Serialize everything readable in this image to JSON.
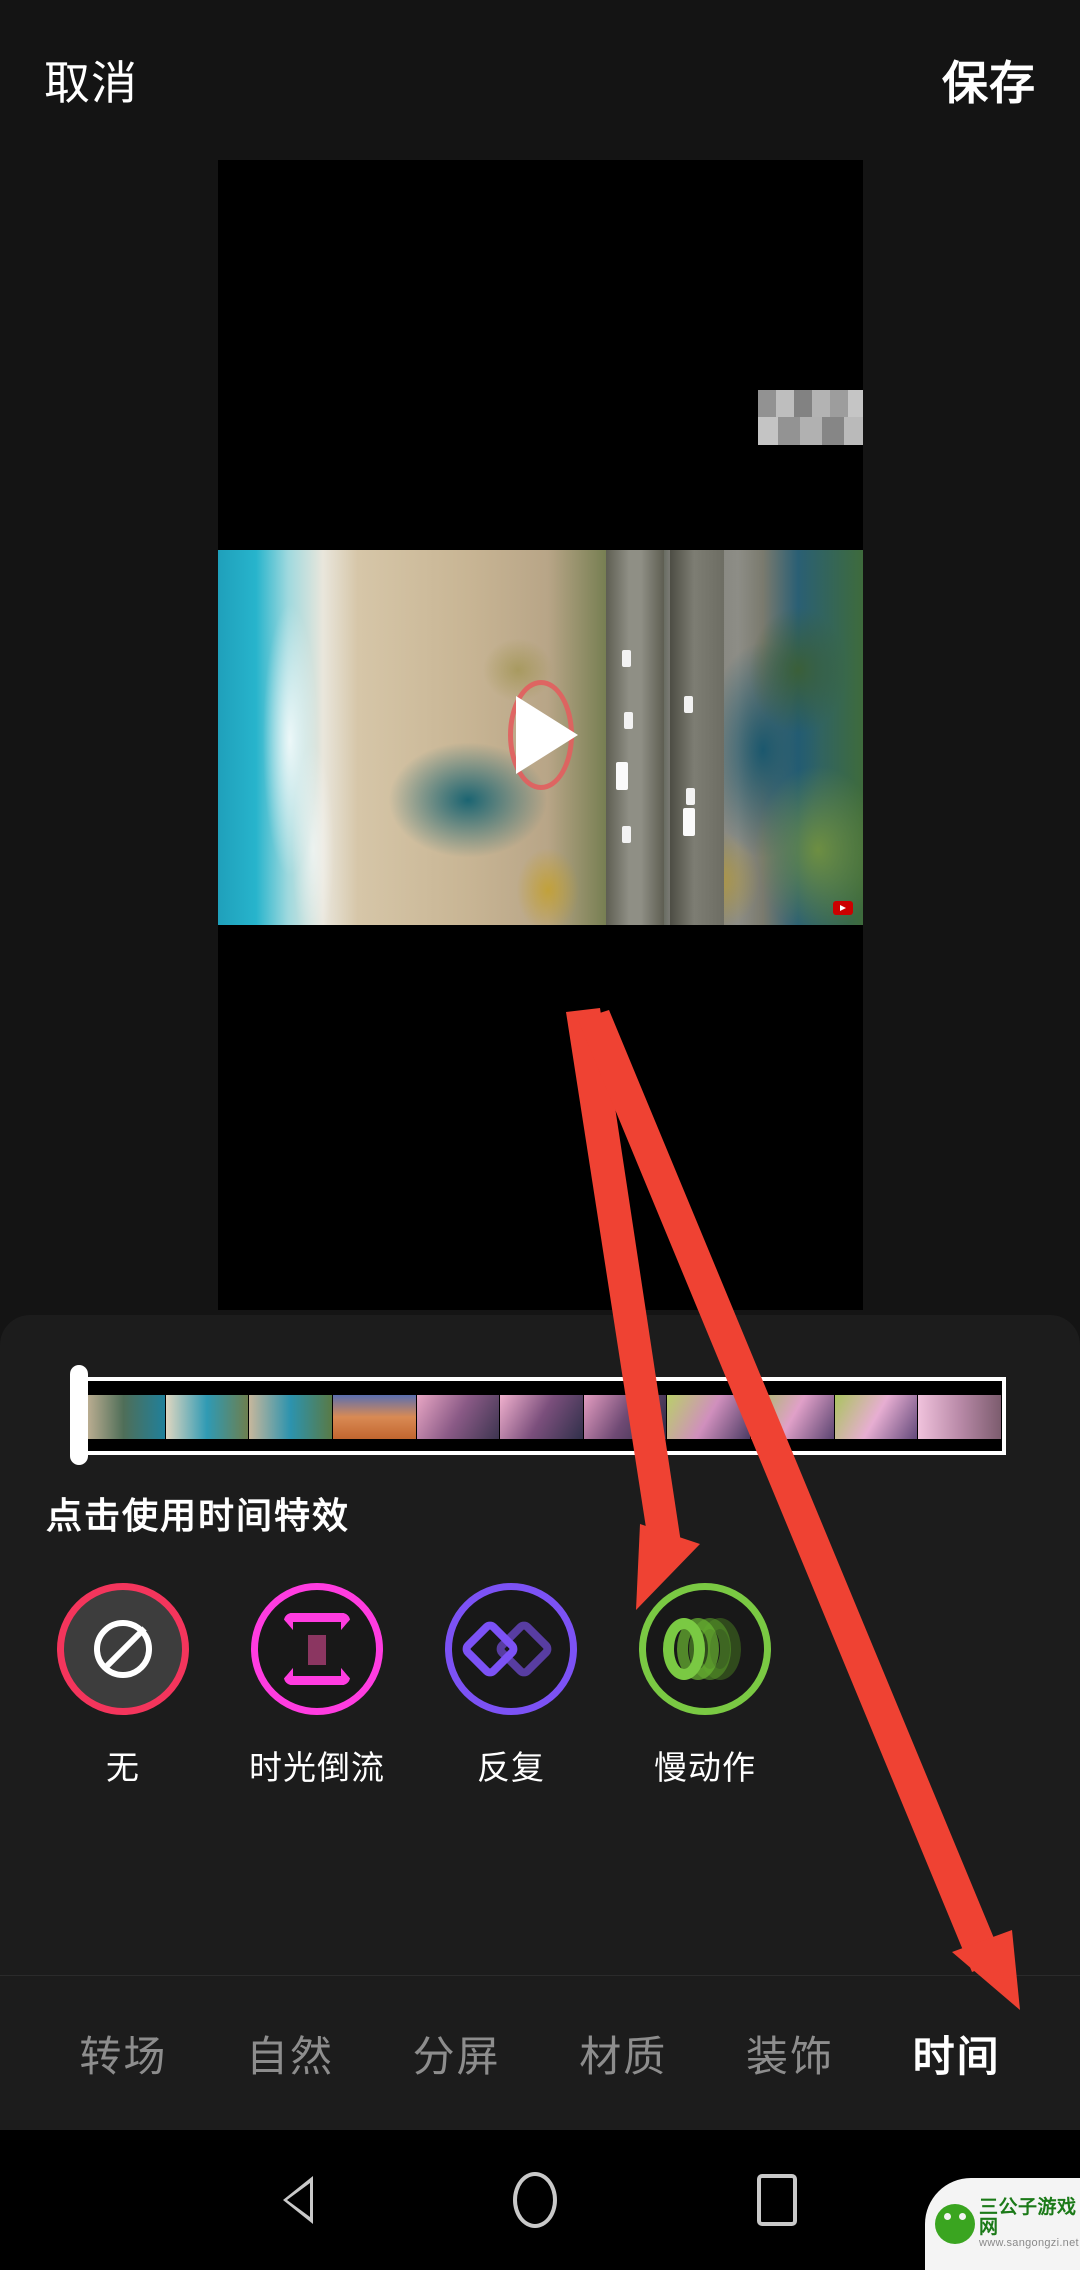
{
  "topbar": {
    "cancel_label": "取消",
    "save_label": "保存"
  },
  "preview": {
    "play_icon": "play-triangle-icon",
    "scene_description": "aerial beach and highway video frame",
    "corner_badge": "youtube-badge"
  },
  "sheet": {
    "hint_title": "点击使用时间特效",
    "timeline": {
      "playhead": "playhead-handle",
      "thumbnail_count": 11
    },
    "effects": [
      {
        "label": "无",
        "icon": "no-effect-icon",
        "ring_color": "#f4355c",
        "selected": true
      },
      {
        "label": "时光倒流",
        "icon": "hourglass-icon",
        "ring_color": "#ff3ce0",
        "selected": false
      },
      {
        "label": "反复",
        "icon": "repeat-diamond-icon",
        "ring_color": "#7c52f5",
        "selected": false
      },
      {
        "label": "慢动作",
        "icon": "slow-motion-icon",
        "ring_color": "#7ac943",
        "selected": false
      }
    ]
  },
  "tabbar": {
    "tabs": [
      {
        "label": "转场",
        "active": false
      },
      {
        "label": "自然",
        "active": false
      },
      {
        "label": "分屏",
        "active": false
      },
      {
        "label": "材质",
        "active": false
      },
      {
        "label": "装饰",
        "active": false
      },
      {
        "label": "时间",
        "active": true
      }
    ]
  },
  "navbar": {
    "back": "back-triangle-icon",
    "home": "home-circle-icon",
    "recents": "recents-square-icon"
  },
  "watermark": {
    "title": "三公子游戏网",
    "url": "www.sangongzi.net",
    "logo": "mascot-logo-icon"
  },
  "annotations": {
    "arrow_color": "#ef4233",
    "arrows": [
      {
        "name": "arrow-to-effects-row"
      },
      {
        "name": "arrow-to-time-tab"
      }
    ]
  }
}
